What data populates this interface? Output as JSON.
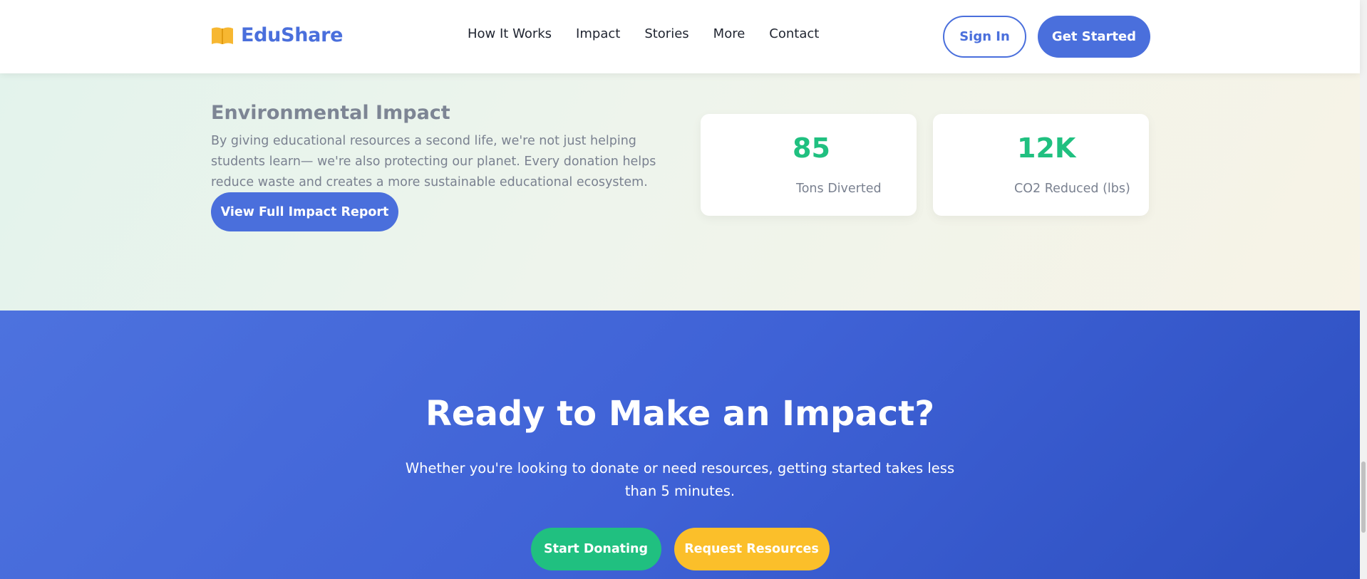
{
  "header": {
    "logo_icon": "open-book-icon",
    "logo_text": "EduShare",
    "nav": [
      "How It Works",
      "Impact",
      "Stories",
      "More",
      "Contact"
    ],
    "sign_in": "Sign In",
    "get_started": "Get Started"
  },
  "environment": {
    "title": "Environmental Impact",
    "text": "By giving educational resources a second life, we're not just helping students learn— we're also protecting our planet. Every donation helps reduce waste and creates a more sustainable educational ecosystem.",
    "button": "View Full Impact Report",
    "stats": [
      {
        "value": "85",
        "label": "Tons Diverted"
      },
      {
        "value": "12K",
        "label": "CO2 Reduced (lbs)"
      }
    ]
  },
  "cta": {
    "title": "Ready to Make an Impact?",
    "text": "Whether you're looking to donate or need resources, getting started takes less than 5 minutes.",
    "donate_button": "Start Donating",
    "request_button": "Request Resources"
  },
  "colors": {
    "primary": "#4a6fdc",
    "green": "#20c080",
    "yellow": "#fbbf2a"
  }
}
